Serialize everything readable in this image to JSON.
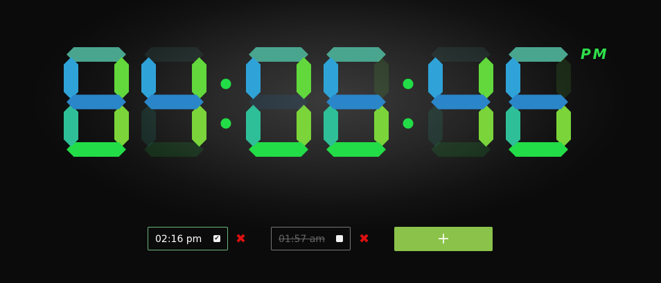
{
  "clock": {
    "digits": [
      8,
      4,
      0,
      6,
      4,
      6
    ],
    "display_time": "4:06:46",
    "meridiem": "PM"
  },
  "alarms": [
    {
      "time": "02:16 pm",
      "enabled": true,
      "check_glyph": "✔",
      "delete_glyph": "✖"
    },
    {
      "time": "01:57 am",
      "enabled": false,
      "check_glyph": "",
      "delete_glyph": "✖"
    }
  ],
  "add_button": {
    "label": "+"
  },
  "colors": {
    "top": "#4aa58f",
    "upper_left": "#2fa3d8",
    "upper_right": "#62d83c",
    "middle": "#2a86c9",
    "lower_left": "#2fbf98",
    "lower_right": "#7ad43a",
    "bottom": "#22dd47",
    "colon": "#22dd47",
    "accent": "#8bc34a",
    "delete": "#e01010"
  }
}
